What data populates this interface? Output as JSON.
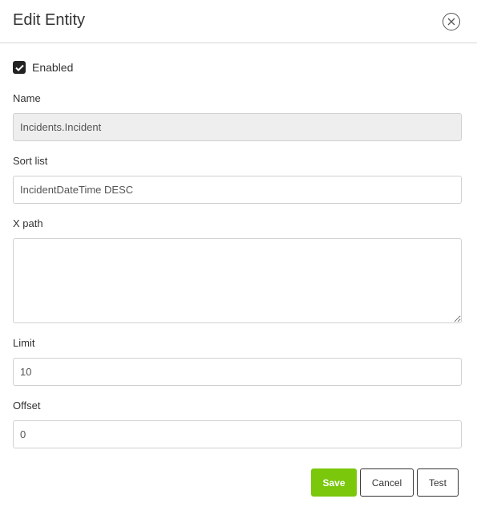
{
  "dialog": {
    "title": "Edit Entity"
  },
  "enabled": {
    "label": "Enabled",
    "checked": true
  },
  "fields": {
    "name": {
      "label": "Name",
      "value": "Incidents.Incident"
    },
    "sort_list": {
      "label": "Sort list",
      "value": "IncidentDateTime DESC"
    },
    "x_path": {
      "label": "X path",
      "value": ""
    },
    "limit": {
      "label": "Limit",
      "value": "10"
    },
    "offset": {
      "label": "Offset",
      "value": "0"
    }
  },
  "buttons": {
    "save": "Save",
    "cancel": "Cancel",
    "test": "Test"
  },
  "colors": {
    "save_button": "#7ac70c",
    "checkbox": "#222222",
    "disabled_field": "#eeeeee"
  },
  "icons": {
    "close": "close-icon",
    "check": "check-icon"
  }
}
